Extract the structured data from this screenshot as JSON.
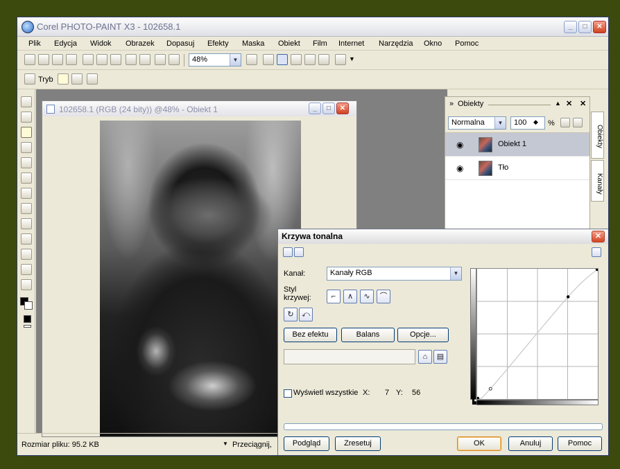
{
  "app": {
    "title": "Corel PHOTO-PAINT X3 - 102658.1"
  },
  "menu": [
    "Plik",
    "Edycja",
    "Widok",
    "Obrazek",
    "Dopasuj",
    "Efekty",
    "Maska",
    "Obiekt",
    "Film",
    "Internet",
    "Narzędzia",
    "Okno",
    "Pomoc"
  ],
  "toolbar": {
    "zoom": "48%",
    "mode_label": "Tryb"
  },
  "document": {
    "title": "102658.1 (RGB (24 bity)) @48% - Obiekt 1"
  },
  "status": {
    "file_size": "Rozmiar pliku: 95.2 KB",
    "hint": "Przeciągnij,"
  },
  "objects_panel": {
    "title": "Obiekty",
    "blend_mode": "Normalna",
    "opacity": "100",
    "percent": "%",
    "layers": [
      {
        "name": "Obiekt 1",
        "selected": true
      },
      {
        "name": "Tło",
        "selected": false
      }
    ],
    "tabs": [
      "Obiekty",
      "Kanały"
    ]
  },
  "dialog": {
    "title": "Krzywa tonalna",
    "channel_label": "Kanał:",
    "channel_value": "Kanały RGB",
    "style_label_1": "Styl",
    "style_label_2": "krzywej:",
    "btn_no_effect": "Bez efektu",
    "btn_balance": "Balans",
    "btn_options": "Opcje...",
    "show_all_label": "Wyświetl wszystkie",
    "x_label": "X:",
    "x_value": "7",
    "y_label": "Y:",
    "y_value": "56",
    "btn_preview": "Podgląd",
    "btn_reset": "Zresetuj",
    "btn_ok": "OK",
    "btn_cancel": "Anuluj",
    "btn_help": "Pomoc"
  },
  "curve": {
    "x_range": [
      0,
      255
    ],
    "y_range": [
      0,
      255
    ],
    "points": [
      {
        "x": 0,
        "y": 0
      },
      {
        "x": 27,
        "y": 19
      },
      {
        "x": 193,
        "y": 201
      },
      {
        "x": 255,
        "y": 255
      }
    ]
  }
}
